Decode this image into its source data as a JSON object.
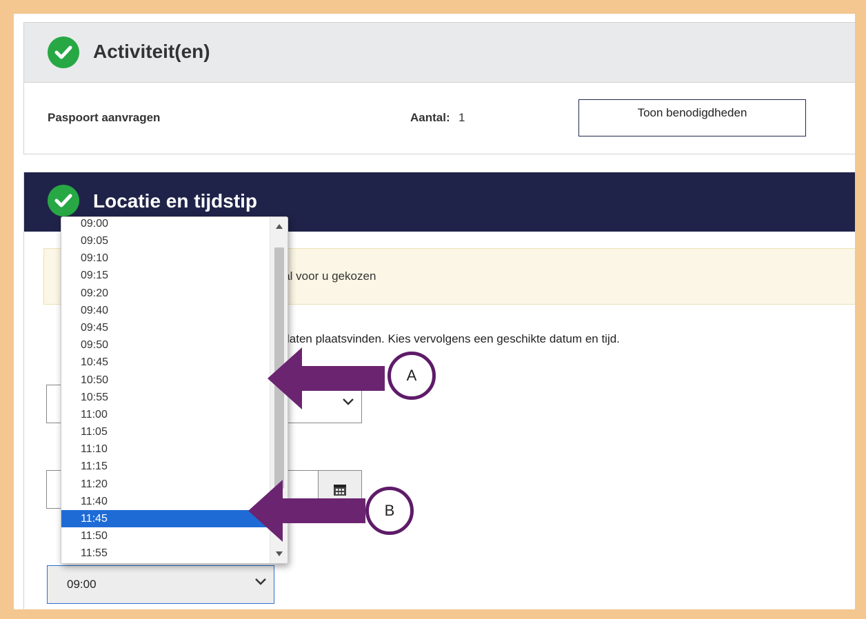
{
  "activities": {
    "title": "Activiteit(en)",
    "item_name": "Paspoort aanvragen",
    "count_label": "Aantal:",
    "count_value": "1",
    "tools_button": "Toon benodigdheden"
  },
  "location": {
    "title": "Locatie en tijdstip",
    "notice_text": "s al voor u gekozen",
    "instruction_text": "ilt laten plaatsvinden. Kies vervolgens een geschikte datum en tijd."
  },
  "time_select": {
    "value": "09:00",
    "options": [
      "09:00",
      "09:05",
      "09:10",
      "09:15",
      "09:20",
      "09:40",
      "09:45",
      "09:50",
      "10:45",
      "10:50",
      "10:55",
      "11:00",
      "11:05",
      "11:10",
      "11:15",
      "11:20",
      "11:40",
      "11:45",
      "11:50",
      "11:55"
    ],
    "selected": "11:45"
  },
  "annotations": {
    "callout_a": "A",
    "callout_b": "B",
    "arrow_color": "#6b2470"
  },
  "colors": {
    "border_frame": "#f4c690",
    "check_green": "#27a844",
    "header_navy": "#1f2349",
    "selected_blue": "#1e6bd6"
  }
}
